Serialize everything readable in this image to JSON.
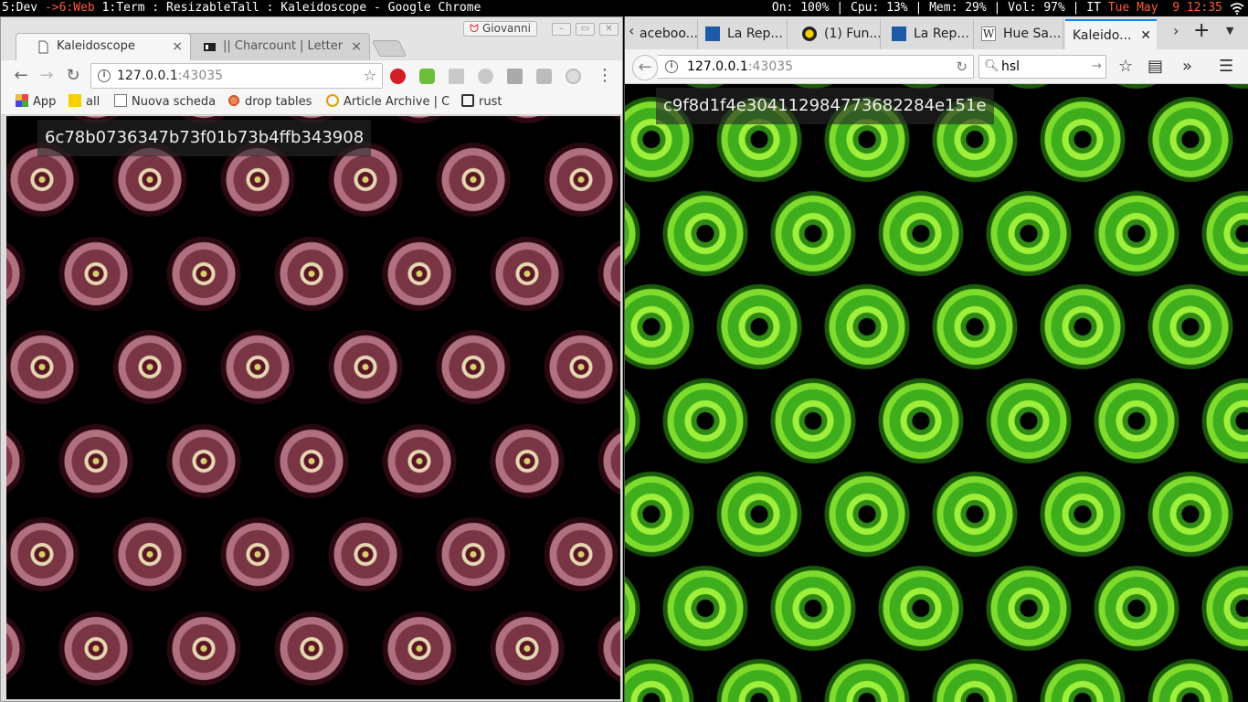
{
  "statusbar": {
    "ws_before": "5:Dev ",
    "ws_active": "->6:Web",
    "ws_after": " 1:Term : ResizableTall : Kaleidoscope - Google Chrome",
    "stats": "On: 100% | Cpu: 13% | Mem: 29% | Vol: 97% | IT ",
    "time": "Tue May  9 12:35"
  },
  "left": {
    "tabs": [
      {
        "label": "Kaleidoscope",
        "close": "×"
      },
      {
        "label": "|| Charcount | Letter",
        "close": "×"
      }
    ],
    "profile": "Giovanni",
    "url_host": "127.0.0.1",
    "url_port": ":43035",
    "bookmarks": {
      "apps": "App",
      "all": "all",
      "nuova": "Nuova scheda",
      "drop": "drop tables",
      "archive": "Article Archive | C",
      "rust": "rust"
    },
    "hash": "6c78b0736347b73f01b73b4ffb343908"
  },
  "right": {
    "tabs": [
      "aceboo...",
      "La Rep...",
      "(1) Fun...",
      "La Rep...",
      "Hue Sa...",
      "Kaleido..."
    ],
    "url_host": "127.0.0.1",
    "url_port": ":43035",
    "search_value": "hsl",
    "hash": "c9f8d1f4e304112984773682284e151e"
  },
  "colors": {
    "accent_red": "#ff5a3c",
    "firefox_tab_accent": "#0a84ff"
  }
}
